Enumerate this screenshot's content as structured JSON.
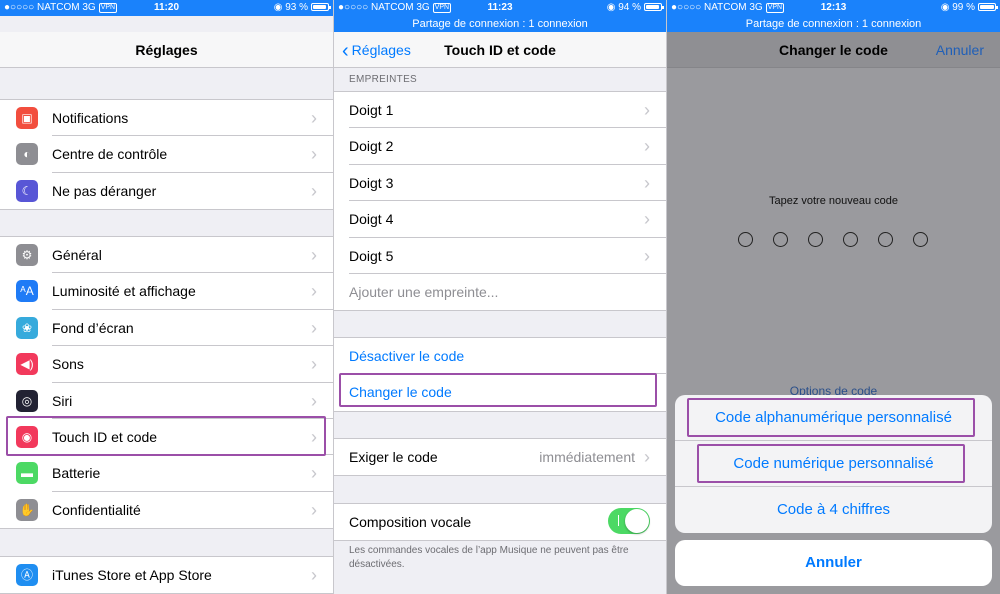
{
  "colors": {
    "accent": "#007aff",
    "statusbar": "#1a82fb",
    "highlight": "#9b4fa8",
    "toggle_on": "#4cd964"
  },
  "panels": [
    {
      "status": {
        "carrier": "●○○○○ NATCOM",
        "network": "3G",
        "vpn": "VPN",
        "time": "11:20",
        "battery": "93 %",
        "battery_level": 0.93
      },
      "nav": {
        "title": "Réglages"
      },
      "groups": [
        [
          {
            "label": "Notifications",
            "icon": "notifications-icon",
            "color": "#f24e3e"
          },
          {
            "label": "Centre de contrôle",
            "icon": "control-center-icon",
            "color": "#8e8e93"
          },
          {
            "label": "Ne pas déranger",
            "icon": "moon-icon",
            "color": "#5856d6"
          }
        ],
        [
          {
            "label": "Général",
            "icon": "gear-icon",
            "color": "#8e8e93"
          },
          {
            "label": "Luminosité et affichage",
            "icon": "brightness-icon",
            "color": "#1f7bf6"
          },
          {
            "label": "Fond d’écran",
            "icon": "wallpaper-icon",
            "color": "#36aadc"
          },
          {
            "label": "Sons",
            "icon": "speaker-icon",
            "color": "#f2395c"
          },
          {
            "label": "Siri",
            "icon": "siri-icon",
            "color": "#222233"
          },
          {
            "label": "Touch ID et code",
            "icon": "fingerprint-icon",
            "color": "#f2395c"
          },
          {
            "label": "Batterie",
            "icon": "battery-icon",
            "color": "#4cd964"
          },
          {
            "label": "Confidentialité",
            "icon": "hand-icon",
            "color": "#8e8e93"
          }
        ],
        [
          {
            "label": "iTunes Store et App Store",
            "icon": "app-store-icon",
            "color": "#1f8ef1"
          }
        ]
      ]
    },
    {
      "status": {
        "carrier": "●○○○○ NATCOM",
        "network": "3G",
        "vpn": "VPN",
        "time": "11:23",
        "battery": "94 %",
        "battery_level": 0.94,
        "hotspot": "Partage de connexion : 1 connexion"
      },
      "nav": {
        "back": "Réglages",
        "title": "Touch ID et code"
      },
      "section_header": "EMPREINTES",
      "fingers": [
        "Doigt 1",
        "Doigt 2",
        "Doigt 3",
        "Doigt 4",
        "Doigt 5"
      ],
      "add_fingerprint": "Ajouter une empreinte...",
      "disable_code": "Désactiver le code",
      "change_code": "Changer le code",
      "require_code": {
        "label": "Exiger le code",
        "value": "immédiatement"
      },
      "voice_dial": {
        "label": "Composition vocale",
        "on": true
      },
      "voice_footnote": "Les commandes vocales de l’app Musique ne peuvent pas être désactivées."
    },
    {
      "status": {
        "carrier": "●○○○○ NATCOM",
        "network": "3G",
        "vpn": "VPN",
        "time": "12:13",
        "battery": "99 %",
        "battery_level": 0.99,
        "hotspot": "Partage de connexion : 1 connexion"
      },
      "nav": {
        "title": "Changer le code",
        "cancel": "Annuler"
      },
      "prompt": "Tapez votre nouveau code",
      "digits": 6,
      "options_link": "Options de code",
      "sheet": [
        "Code alphanumérique personnalisé",
        "Code numérique personnalisé",
        "Code à 4 chiffres"
      ],
      "cancel": "Annuler"
    }
  ]
}
